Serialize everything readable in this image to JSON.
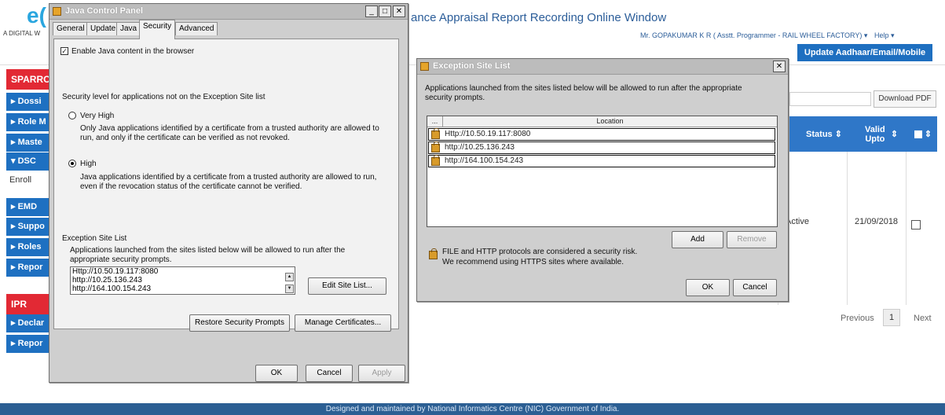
{
  "page": {
    "logo_text": "e(",
    "logo_tagline": "A DIGITAL W",
    "title": "ance Appraisal Report Recording Online Window",
    "user": "Mr. GOPAKUMAR K R  ( Asstt. Programmer - RAIL WHEEL FACTORY)",
    "user_caret": "▾",
    "help": "Help ▾",
    "update_button": "Update Aadhaar/Email/Mobile",
    "download_pdf": "Download PDF",
    "footer": "Designed and maintained by National Informatics Centre (NIC) Government of India."
  },
  "sidebar": {
    "sparrow": "SPARRO",
    "ipr": "IPR",
    "enroll": "Enroll",
    "items": [
      {
        "label": "▸ Dossi"
      },
      {
        "label": "▸ Role M"
      },
      {
        "label": "▸ Maste"
      },
      {
        "label": "▾ DSC"
      },
      {
        "label": "▸ EMD"
      },
      {
        "label": "▸ Suppo"
      },
      {
        "label": "▸ Roles"
      },
      {
        "label": "▸ Repor"
      },
      {
        "label": "▸ Declar"
      },
      {
        "label": "▸ Repor"
      }
    ]
  },
  "table": {
    "col_status": "Status",
    "col_valid": "Valid Upto",
    "sort_icon": "⇕",
    "row_status": "Active",
    "row_valid": "21/09/2018"
  },
  "pager": {
    "previous": "Previous",
    "current": "1",
    "next": "Next"
  },
  "jcp": {
    "title": "Java Control Panel",
    "tabs": [
      "General",
      "Update",
      "Java",
      "Security",
      "Advanced"
    ],
    "enable_java": "Enable Java content in the browser",
    "security_level_heading": "Security level for applications not on the Exception Site list",
    "very_high_label": "Very High",
    "very_high_desc": "Only Java applications identified by a certificate from a trusted authority are allowed to run, and only if the certificate can be verified as not revoked.",
    "high_label": "High",
    "high_desc": "Java applications identified by a certificate from a trusted authority are allowed to run, even if the revocation status of the certificate cannot be verified.",
    "exception_heading": "Exception Site List",
    "exception_desc": "Applications launched from the sites listed below will be allowed to run after the appropriate security prompts.",
    "sites": [
      "Http://10.50.19.117:8080",
      "http://10.25.136.243",
      "http://164.100.154.243"
    ],
    "edit_site_list": "Edit Site List...",
    "restore_prompts": "Restore Security Prompts",
    "manage_certs": "Manage Certificates...",
    "ok": "OK",
    "cancel": "Cancel",
    "apply": "Apply"
  },
  "esl": {
    "title": "Exception Site List",
    "desc": "Applications launched from the sites listed below will be allowed to run after the appropriate security prompts.",
    "col_dots": "...",
    "col_location": "Location",
    "sites": [
      "Http://10.50.19.117:8080",
      "http://10.25.136.243",
      "http://164.100.154.243"
    ],
    "add": "Add",
    "remove": "Remove",
    "warning_line1": "FILE and HTTP protocols are considered a security risk.",
    "warning_line2": "We recommend using HTTPS sites where available.",
    "ok": "OK",
    "cancel": "Cancel"
  }
}
